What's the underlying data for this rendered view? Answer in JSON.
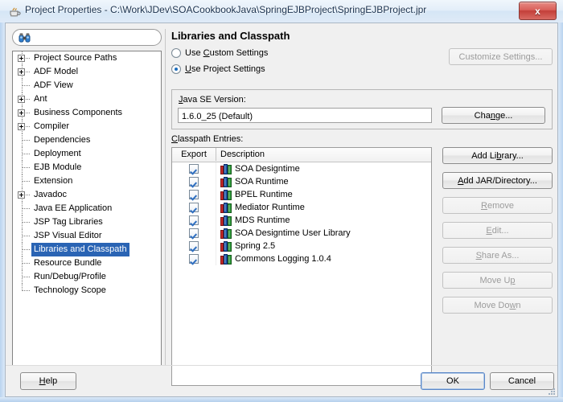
{
  "window": {
    "title": "Project Properties - C:\\Work\\JDev\\SOACookbookJava\\SpringEJBProject\\SpringEJBProject.jpr",
    "icon": "java-coffee-cup-icon",
    "close_label": "x",
    "close_color": "#c33f39"
  },
  "sidebar": {
    "search": {
      "value": "",
      "placeholder": "",
      "icon": "binoculars-search-icon"
    },
    "selected": "Libraries and Classpath",
    "items": [
      {
        "label": "Project Source Paths",
        "expandable": true
      },
      {
        "label": "ADF Model",
        "expandable": true
      },
      {
        "label": "ADF View",
        "expandable": false
      },
      {
        "label": "Ant",
        "expandable": true
      },
      {
        "label": "Business Components",
        "expandable": true
      },
      {
        "label": "Compiler",
        "expandable": true
      },
      {
        "label": "Dependencies",
        "expandable": false
      },
      {
        "label": "Deployment",
        "expandable": false
      },
      {
        "label": "EJB Module",
        "expandable": false
      },
      {
        "label": "Extension",
        "expandable": false
      },
      {
        "label": "Javadoc",
        "expandable": true
      },
      {
        "label": "Java EE Application",
        "expandable": false
      },
      {
        "label": "JSP Tag Libraries",
        "expandable": false
      },
      {
        "label": "JSP Visual Editor",
        "expandable": false
      },
      {
        "label": "Libraries and Classpath",
        "expandable": false
      },
      {
        "label": "Resource Bundle",
        "expandable": false
      },
      {
        "label": "Run/Debug/Profile",
        "expandable": false
      },
      {
        "label": "Technology Scope",
        "expandable": false
      }
    ]
  },
  "panel": {
    "title": "Libraries and Classpath",
    "settings_mode": {
      "custom": {
        "label_pre": "Use ",
        "mnemonic": "C",
        "label_post": "ustom Settings",
        "selected": false
      },
      "project": {
        "label_pre": "",
        "mnemonic": "U",
        "label_post": "se Project Settings",
        "selected": true
      }
    },
    "customize_settings_button": {
      "label": "Customize Settings...",
      "enabled": false
    },
    "java_se": {
      "label_pre": "",
      "mnemonic": "J",
      "label_post": "ava SE Version:",
      "value": "1.6.0_25 (Default)",
      "change_button": {
        "label_pre": "Cha",
        "mnemonic": "n",
        "label_post": "ge...",
        "enabled": true
      }
    },
    "classpath": {
      "label_pre": "",
      "mnemonic": "C",
      "label_post": "lasspath Entries:",
      "columns": [
        "Export",
        "Description"
      ],
      "entries": [
        {
          "export": true,
          "description": "SOA Designtime",
          "icon": "library-books-icon"
        },
        {
          "export": true,
          "description": "SOA Runtime",
          "icon": "library-books-icon"
        },
        {
          "export": true,
          "description": "BPEL Runtime",
          "icon": "library-books-icon"
        },
        {
          "export": true,
          "description": "Mediator Runtime",
          "icon": "library-books-icon"
        },
        {
          "export": true,
          "description": "MDS Runtime",
          "icon": "library-books-icon"
        },
        {
          "export": true,
          "description": "SOA Designtime User Library",
          "icon": "library-books-icon"
        },
        {
          "export": true,
          "description": "Spring 2.5",
          "icon": "library-books-icon"
        },
        {
          "export": true,
          "description": "Commons Logging 1.0.4",
          "icon": "library-books-icon"
        }
      ]
    },
    "side_buttons": [
      {
        "label_pre": "Add Li",
        "mnemonic": "b",
        "label_post": "rary...",
        "enabled": true,
        "name": "add-library-button"
      },
      {
        "label_pre": "",
        "mnemonic": "A",
        "label_post": "dd JAR/Directory...",
        "enabled": true,
        "name": "add-jar-directory-button"
      },
      {
        "label_pre": "",
        "mnemonic": "R",
        "label_post": "emove",
        "enabled": false,
        "name": "remove-button"
      },
      {
        "label_pre": "",
        "mnemonic": "E",
        "label_post": "dit...",
        "enabled": false,
        "name": "edit-button"
      },
      {
        "label_pre": "",
        "mnemonic": "S",
        "label_post": "hare As...",
        "enabled": false,
        "name": "share-as-button"
      },
      {
        "label_pre": "Move U",
        "mnemonic": "p",
        "label_post": "",
        "enabled": false,
        "name": "move-up-button"
      },
      {
        "label_pre": "Move Do",
        "mnemonic": "w",
        "label_post": "n",
        "enabled": false,
        "name": "move-down-button"
      }
    ]
  },
  "footer": {
    "help": {
      "label_pre": "",
      "mnemonic": "H",
      "label_post": "elp"
    },
    "ok": {
      "label": "OK",
      "default": true
    },
    "cancel": {
      "label": "Cancel"
    }
  }
}
